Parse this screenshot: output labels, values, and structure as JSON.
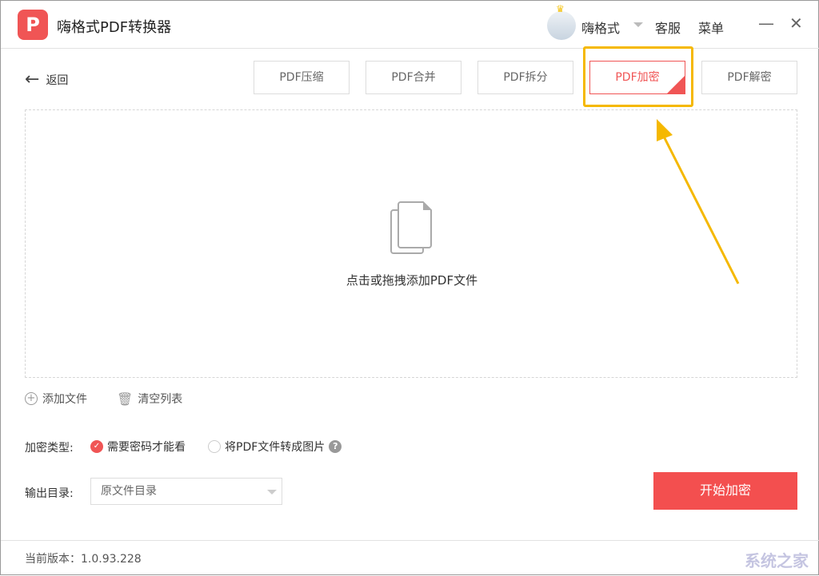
{
  "app": {
    "logo_letter": "P",
    "title": "嗨格式PDF转换器"
  },
  "header": {
    "username": "嗨格式",
    "service": "客服",
    "menu": "菜单",
    "minimize": "—",
    "close": "✕"
  },
  "nav": {
    "back": "返回"
  },
  "tabs": [
    {
      "label": "PDF压缩"
    },
    {
      "label": "PDF合并"
    },
    {
      "label": "PDF拆分"
    },
    {
      "label": "PDF加密",
      "active": true
    },
    {
      "label": "PDF解密"
    }
  ],
  "dropzone": {
    "text": "点击或拖拽添加PDF文件"
  },
  "actions": {
    "add": "添加文件",
    "clear": "清空列表"
  },
  "encryption": {
    "label": "加密类型:",
    "options": [
      {
        "label": "需要密码才能看",
        "selected": true
      },
      {
        "label": "将PDF文件转成图片",
        "selected": false
      }
    ],
    "help": "?"
  },
  "output": {
    "label": "输出目录:",
    "value": "原文件目录"
  },
  "start_button": "开始加密",
  "footer": {
    "version": "当前版本：1.0.93.228"
  },
  "watermark": "系统之家",
  "colors": {
    "accent": "#f34f4f",
    "highlight": "#f5b800"
  }
}
